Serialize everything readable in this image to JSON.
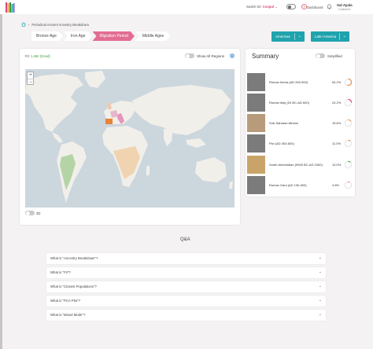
{
  "header": {
    "switch_kit_label": "Switch Kit:",
    "kit_name": "Coopul",
    "dashboard_label": "Dashboard",
    "user_name": "Sal Ayala",
    "user_role": "Customer"
  },
  "breadcrumb": {
    "label": "Periodical Ancient Ancestry Breakdown"
  },
  "eras": [
    {
      "label": "Bronze Age",
      "active": false
    },
    {
      "label": "Iron Age",
      "active": false
    },
    {
      "label": "Migration Period",
      "active": true
    },
    {
      "label": "Middle Ages",
      "active": false
    }
  ],
  "selects": {
    "region": "Americas",
    "subregion": "Latin America"
  },
  "map_panel": {
    "fit_label": "Fit:",
    "fit_value": "1.462 (Good)",
    "show_all_label": "Show All Regions",
    "bottom_toggle_label": "3D"
  },
  "summary": {
    "title": "Summary",
    "simplified_label": "Simplified",
    "populations": [
      {
        "name": "Roman Iberia (AD 260-500)",
        "percent": "54.2%",
        "value": 54.2,
        "color": "#e8955a"
      },
      {
        "name": "Roman Italy (20 BC-AD 600)",
        "percent": "24.2%",
        "value": 24.2,
        "color": "#e0457b"
      },
      {
        "name": "Sub-Saharan African",
        "percent": "15.6%",
        "value": 15.6,
        "color": "#e8a25a"
      },
      {
        "name": "Pict (AD 300-600)",
        "percent": "11.0%",
        "value": 11.0,
        "color": "#e8955a"
      },
      {
        "name": "South Amerindian (9000 BC-AD 1500)",
        "percent": "10.0%",
        "value": 10.0,
        "color": "#3b9b3b"
      },
      {
        "name": "Roman Gaul (AD 130-500)",
        "percent": "4.8%",
        "value": 4.8,
        "color": "#e0457b"
      }
    ]
  },
  "qa": {
    "title": "Q&A",
    "items": [
      "What is \"Ancestry Breakdown\"?",
      "What is \"Fit\"?",
      "What is \"Closest Populations\"?",
      "What is \"PCA Plot\"?",
      "What is \"Mixed Mode\"?"
    ]
  },
  "colors": {
    "accent_teal": "#1fa3ad",
    "accent_pink": "#e26d93",
    "page_bg": "#f4f2f3"
  }
}
